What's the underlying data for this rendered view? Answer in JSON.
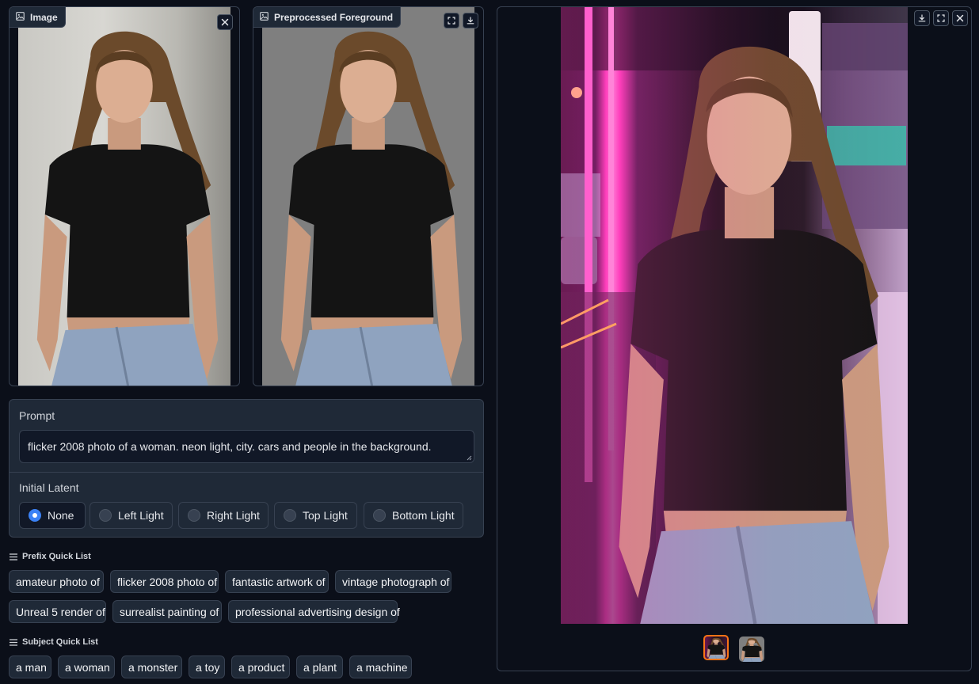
{
  "input_image": {
    "label": "Image",
    "icon": "image-icon",
    "close_icon": "close-icon"
  },
  "foreground_image": {
    "label": "Preprocessed Foreground",
    "icon": "image-icon",
    "fullscreen_icon": "fullscreen-icon",
    "download_icon": "download-icon"
  },
  "gallery": {
    "download_icon": "download-icon",
    "fullscreen_icon": "fullscreen-icon",
    "close_icon": "close-icon",
    "thumbnail_count": 2,
    "selected_thumbnail": 0
  },
  "prompt": {
    "label": "Prompt",
    "value": "flicker 2008 photo of a woman. neon light, city. cars and people in the background."
  },
  "initial_latent": {
    "label": "Initial Latent",
    "options": [
      "None",
      "Left Light",
      "Right Light",
      "Top Light",
      "Bottom Light"
    ],
    "selected": "None"
  },
  "prefix_quick_list": {
    "label": "Prefix Quick List",
    "icon": "list-icon",
    "items": [
      "amateur photo of",
      "flicker 2008 photo of",
      "fantastic artwork of",
      "vintage photograph of",
      "Unreal 5 render of",
      "surrealist painting of",
      "professional advertising design of"
    ]
  },
  "subject_quick_list": {
    "label": "Subject Quick List",
    "icon": "list-icon",
    "items": [
      "a man",
      "a woman",
      "a monster",
      "a toy",
      "a product",
      "a plant",
      "a machine"
    ]
  },
  "colors": {
    "background": "#0b0f19",
    "panel": "#1f2937",
    "border": "#374151",
    "accent": "#3b82f6",
    "neon": "#ff3fbf"
  }
}
